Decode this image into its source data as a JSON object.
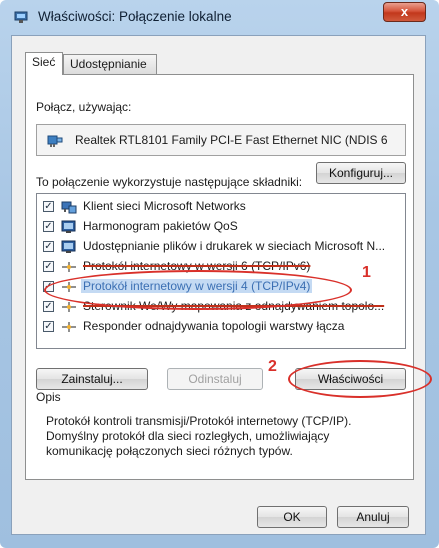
{
  "window": {
    "title": "Właściwości: Połączenie lokalne",
    "close_label": "x"
  },
  "tabs": [
    {
      "label": "Sieć",
      "active": true
    },
    {
      "label": "Udostępnianie",
      "active": false
    }
  ],
  "connect_using": {
    "label": "Połącz, używając:",
    "adapter": "Realtek RTL8101 Family PCI-E Fast Ethernet NIC (NDIS 6"
  },
  "buttons": {
    "configure": "Konfiguruj...",
    "install": "Zainstaluj...",
    "uninstall": "Odinstaluj",
    "properties": "Właściwości",
    "ok": "OK",
    "cancel": "Anuluj"
  },
  "components": {
    "label": "To połączenie wykorzystuje następujące składniki:",
    "items": [
      {
        "label": "Klient sieci Microsoft Networks",
        "checked": true,
        "icon": "network-client-icon"
      },
      {
        "label": "Harmonogram pakietów QoS",
        "checked": true,
        "icon": "service-icon"
      },
      {
        "label": "Udostępnianie plików i drukarek w sieciach Microsoft N...",
        "checked": true,
        "icon": "service-icon"
      },
      {
        "label": "Protokół internetowy w wersji 6 (TCP/IPv6)",
        "checked": true,
        "icon": "protocol-icon"
      },
      {
        "label": "Protokół internetowy w wersji 4 (TCP/IPv4)",
        "checked": true,
        "icon": "protocol-icon",
        "selected": true
      },
      {
        "label": "Sterownik We/Wy mapowania z odnajdywaniem topolo...",
        "checked": true,
        "icon": "protocol-icon"
      },
      {
        "label": "Responder odnajdywania topologii warstwy łącza",
        "checked": true,
        "icon": "protocol-icon"
      }
    ]
  },
  "description": {
    "title": "Opis",
    "text": "Protokół kontroli transmisji/Protokół internetowy (TCP/IP). Domyślny protokół dla sieci rozległych, umożliwiający komunikację połączonych sieci różnych typów."
  },
  "annotations": {
    "step1": "1",
    "step2": "2",
    "color": "#d9302a"
  },
  "colors": {
    "selection": "#c4daf3",
    "frame": "#a8c6e4",
    "close": "#c2381c"
  }
}
